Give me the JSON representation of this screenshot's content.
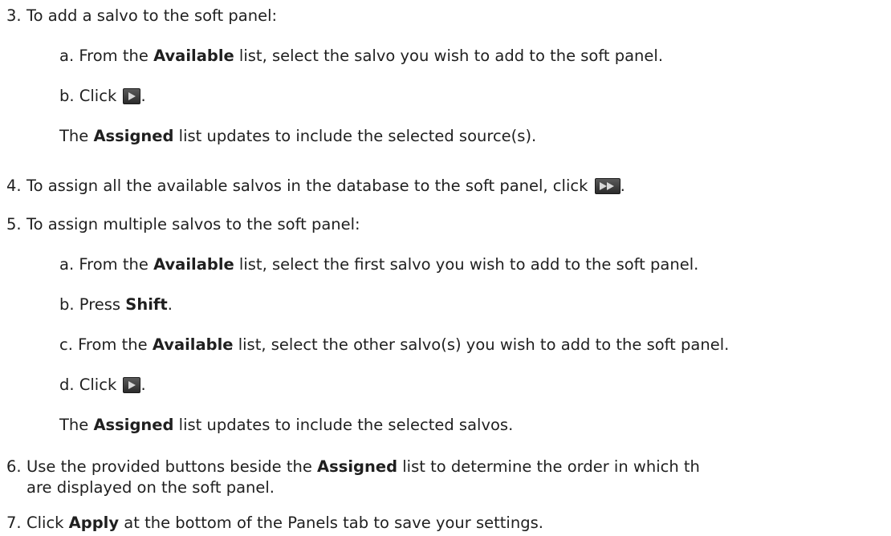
{
  "steps": {
    "s3": {
      "num": "3.",
      "text": "To add a salvo to the soft panel:",
      "a": {
        "pre": "a.  From the ",
        "bold": "Available",
        "post": " list, select the salvo you wish to add to the soft panel."
      },
      "b": {
        "pre": "b.  Click ",
        "post": "."
      },
      "result": {
        "pre": "The ",
        "bold": "Assigned",
        "post": " list updates to include the selected source(s)."
      }
    },
    "s4": {
      "num": "4.",
      "pre": "To assign all the available salvos in the database to the soft panel, click ",
      "post": "."
    },
    "s5": {
      "num": "5.",
      "text": "To assign multiple salvos to the soft panel:",
      "a": {
        "pre": "a.  From the ",
        "bold": "Available",
        "post": " list, select the first salvo you wish to add to the soft panel."
      },
      "b": {
        "pre": "b.  Press ",
        "bold": "Shift",
        "post": "."
      },
      "c": {
        "pre": "c.  From the ",
        "bold": "Available",
        "post": " list, select the other salvo(s) you wish to add to the soft panel."
      },
      "d": {
        "pre": "d.  Click ",
        "post": "."
      },
      "result": {
        "pre": "The ",
        "bold": "Assigned",
        "post": " list updates to include the selected salvos."
      }
    },
    "s6": {
      "num": "6.",
      "pre": "Use the provided buttons beside the ",
      "bold": "Assigned",
      "post": " list to determine the order in which th",
      "line2": "are displayed on the soft panel."
    },
    "s7": {
      "num": "7.",
      "pre": "Click ",
      "bold": "Apply",
      "post": " at the bottom of the Panels tab to save your settings."
    }
  },
  "icons": {
    "assign_one": "play-right-arrow-icon",
    "assign_all": "double-right-arrow-icon"
  },
  "colors": {
    "text": "#1f1f1f",
    "button_bg": "#3c3c3c",
    "button_arrow": "#d8d8d8"
  }
}
